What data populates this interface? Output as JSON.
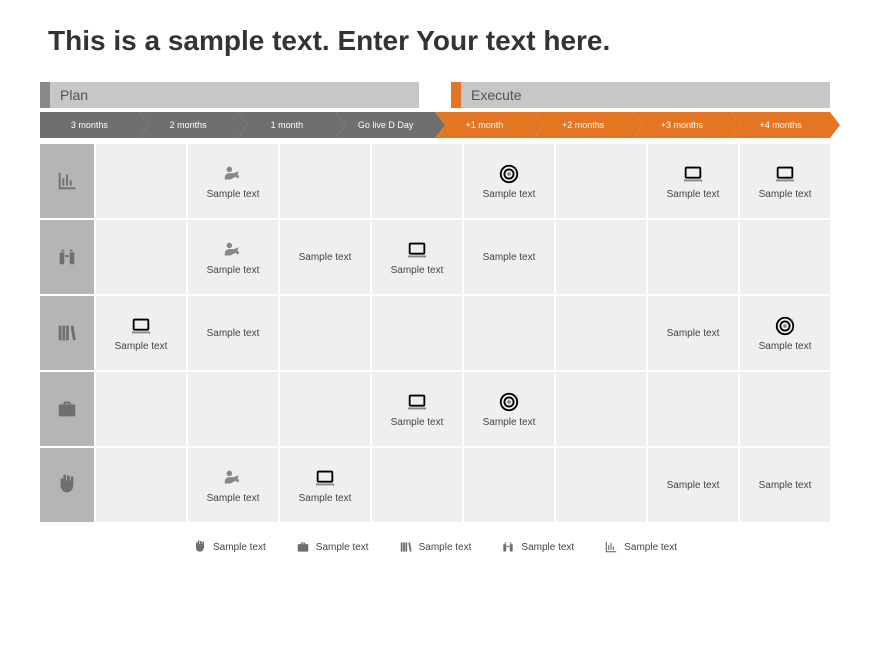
{
  "title": "This is a sample text. Enter Your text here.",
  "phases": {
    "plan": "Plan",
    "execute": "Execute"
  },
  "timeline": [
    "3 months",
    "2 months",
    "1 month",
    "Go live D Day",
    "+1 month",
    "+2 months",
    "+3 months",
    "+4 months"
  ],
  "row_icons": [
    "chart-icon",
    "binoculars-icon",
    "books-icon",
    "briefcase-icon",
    "fist-icon"
  ],
  "cells": [
    [
      null,
      {
        "icon": "megaphone-icon",
        "text": "Sample text"
      },
      null,
      null,
      {
        "icon": "target-icon",
        "text": "Sample text"
      },
      null,
      {
        "icon": "laptop-icon",
        "text": "Sample text"
      },
      {
        "icon": "laptop-icon",
        "text": "Sample text"
      }
    ],
    [
      null,
      {
        "icon": "megaphone-icon",
        "text": "Sample text"
      },
      {
        "text": "Sample text"
      },
      {
        "icon": "laptop-icon",
        "text": "Sample text"
      },
      {
        "text": "Sample text"
      },
      null,
      null,
      null
    ],
    [
      {
        "icon": "laptop-icon",
        "text": "Sample text"
      },
      {
        "text": "Sample text"
      },
      null,
      null,
      null,
      null,
      {
        "text": "Sample text"
      },
      {
        "icon": "target-icon",
        "text": "Sample text"
      }
    ],
    [
      null,
      null,
      null,
      {
        "icon": "laptop-icon",
        "text": "Sample text"
      },
      {
        "icon": "target-icon",
        "text": "Sample text"
      },
      null,
      null,
      null
    ],
    [
      null,
      {
        "icon": "megaphone-icon",
        "text": "Sample text"
      },
      {
        "icon": "laptop-icon",
        "text": "Sample text"
      },
      null,
      null,
      null,
      {
        "text": "Sample text"
      },
      {
        "text": "Sample text"
      }
    ]
  ],
  "legend": [
    {
      "icon": "fist-icon",
      "text": "Sample text"
    },
    {
      "icon": "briefcase-icon",
      "text": "Sample text"
    },
    {
      "icon": "books-icon",
      "text": "Sample text"
    },
    {
      "icon": "binoculars-icon",
      "text": "Sample text"
    },
    {
      "icon": "chart-icon",
      "text": "Sample text"
    }
  ]
}
